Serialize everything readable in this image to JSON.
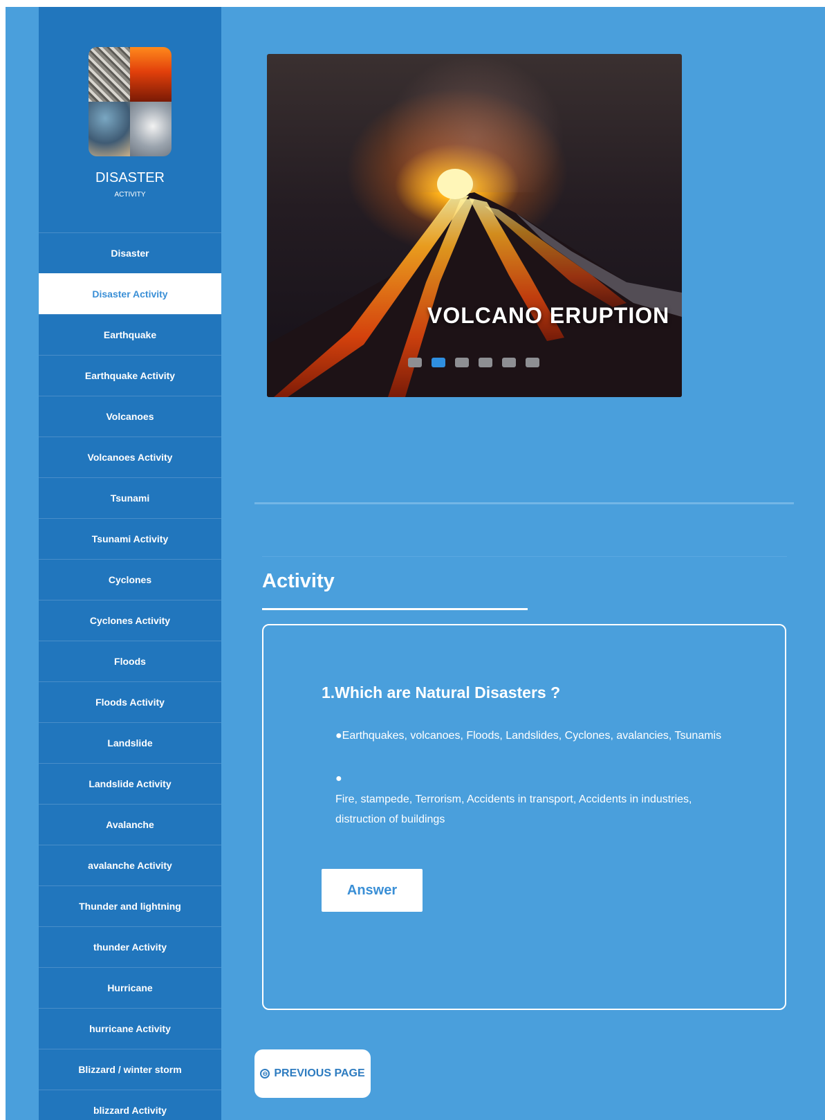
{
  "brand": {
    "title": "DISASTER",
    "subtitle": "ACTIVITY"
  },
  "sidebar": {
    "items": [
      {
        "label": "Disaster",
        "active": false
      },
      {
        "label": "Disaster Activity",
        "active": true
      },
      {
        "label": "Earthquake",
        "active": false
      },
      {
        "label": "Earthquake Activity",
        "active": false
      },
      {
        "label": "Volcanoes",
        "active": false
      },
      {
        "label": "Volcanoes Activity",
        "active": false
      },
      {
        "label": "Tsunami",
        "active": false
      },
      {
        "label": "Tsunami Activity",
        "active": false
      },
      {
        "label": "Cyclones",
        "active": false
      },
      {
        "label": "Cyclones Activity",
        "active": false
      },
      {
        "label": "Floods",
        "active": false
      },
      {
        "label": "Floods Activity",
        "active": false
      },
      {
        "label": "Landslide",
        "active": false
      },
      {
        "label": "Landslide Activity",
        "active": false
      },
      {
        "label": "Avalanche",
        "active": false
      },
      {
        "label": "avalanche Activity",
        "active": false
      },
      {
        "label": "Thunder and lightning",
        "active": false
      },
      {
        "label": "thunder Activity",
        "active": false
      },
      {
        "label": "Hurricane",
        "active": false
      },
      {
        "label": "hurricane Activity",
        "active": false
      },
      {
        "label": "Blizzard / winter storm",
        "active": false
      },
      {
        "label": "blizzard Activity",
        "active": false
      }
    ]
  },
  "carousel": {
    "caption": "VOLCANO ERUPTION",
    "slide_count": 6,
    "active_index": 1
  },
  "activity": {
    "title": "Activity",
    "question": "1.Which are Natural Disasters ?",
    "option1": "●Earthquakes, volcanoes, Floods, Landslides, Cyclones, avalancies, Tsunamis",
    "option2_bullet": "●",
    "option2": "Fire, stampede, Terrorism, Accidents in transport, Accidents in industries, distruction of buildings",
    "answer_label": "Answer"
  },
  "footer": {
    "prev_icon": "⊖",
    "prev_label": "PREVIOUS PAGE"
  },
  "colors": {
    "page_bg": "#4a9fdc",
    "sidebar_bg": "#2176bd",
    "active_text": "#3a8fd6"
  }
}
